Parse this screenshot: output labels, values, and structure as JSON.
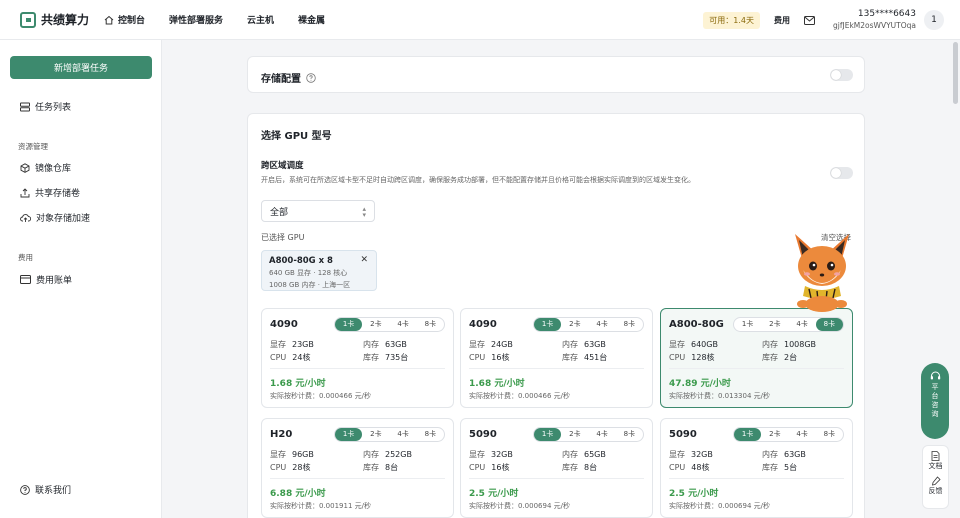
{
  "brand": {
    "name": "共绩算力"
  },
  "nav": {
    "console": "控制台",
    "elastic": "弹性部署服务",
    "cloud_host": "云主机",
    "bare_metal": "裸金属"
  },
  "header": {
    "available": "可用：1.4天",
    "fee": "费用",
    "phone": "135****6643",
    "account_id": "gjfJEkM2osWVYUTOqa",
    "avatar_text": "1"
  },
  "sidebar": {
    "new_task": "新增部署任务",
    "task_list": "任务列表",
    "group_resources": "资源管理",
    "image_repo": "镜像仓库",
    "shared_storage": "共享存储卷",
    "object_storage": "对象存储加速",
    "group_fee": "费用",
    "billing": "费用账单",
    "contact": "联系我们"
  },
  "storage": {
    "title": "存储配置",
    "enabled": false
  },
  "gpu_section": {
    "title": "选择 GPU 型号",
    "cross_title": "跨区域调度",
    "cross_desc": "开启后，系统可在所选区域卡型不足时自动跨区调度，确保服务成功部署，但不能配置存储并且价格可能会根据实际调度到的区域发生变化。",
    "cross_enabled": false,
    "region": "全部",
    "selected_label": "已选择 GPU",
    "clear": "清空选择",
    "chip": {
      "name": "A800-80G x 8",
      "line1": "640 GB 显存 · 128 核心",
      "line2": "1008 GB 内存 · 上海一区"
    }
  },
  "labels": {
    "vram": "显存",
    "mem": "内存",
    "cpu": "CPU",
    "stock": "库存",
    "per_sec_prefix": "实际按秒计费："
  },
  "card_options": [
    "1卡",
    "2卡",
    "4卡",
    "8卡"
  ],
  "gpus": [
    {
      "name": "4090",
      "vram": "23GB",
      "mem": "63GB",
      "cpu": "24核",
      "stock": "735台",
      "price": "1.68 元/小时",
      "sec": "0.000466 元/秒",
      "active": 0,
      "selected": false
    },
    {
      "name": "4090",
      "vram": "24GB",
      "mem": "63GB",
      "cpu": "16核",
      "stock": "451台",
      "price": "1.68 元/小时",
      "sec": "0.000466 元/秒",
      "active": 0,
      "selected": false
    },
    {
      "name": "A800-80G",
      "vram": "640GB",
      "mem": "1008GB",
      "cpu": "128核",
      "stock": "2台",
      "price": "47.89 元/小时",
      "sec": "0.013304 元/秒",
      "active": 3,
      "selected": true
    },
    {
      "name": "H20",
      "vram": "96GB",
      "mem": "252GB",
      "cpu": "28核",
      "stock": "8台",
      "price": "6.88 元/小时",
      "sec": "0.001911 元/秒",
      "active": 0,
      "selected": false
    },
    {
      "name": "5090",
      "vram": "32GB",
      "mem": "65GB",
      "cpu": "16核",
      "stock": "8台",
      "price": "2.5 元/小时",
      "sec": "0.000694 元/秒",
      "active": 0,
      "selected": false
    },
    {
      "name": "5090",
      "vram": "32GB",
      "mem": "63GB",
      "cpu": "48核",
      "stock": "5台",
      "price": "2.5 元/小时",
      "sec": "0.000694 元/秒",
      "active": 0,
      "selected": false
    }
  ],
  "float": {
    "support": "平台咨询",
    "docs": "文档",
    "feedback": "反馈"
  },
  "colors": {
    "accent": "#3d8a6e",
    "price": "#3b9a4c",
    "badge_bg": "#fdf3d4"
  }
}
